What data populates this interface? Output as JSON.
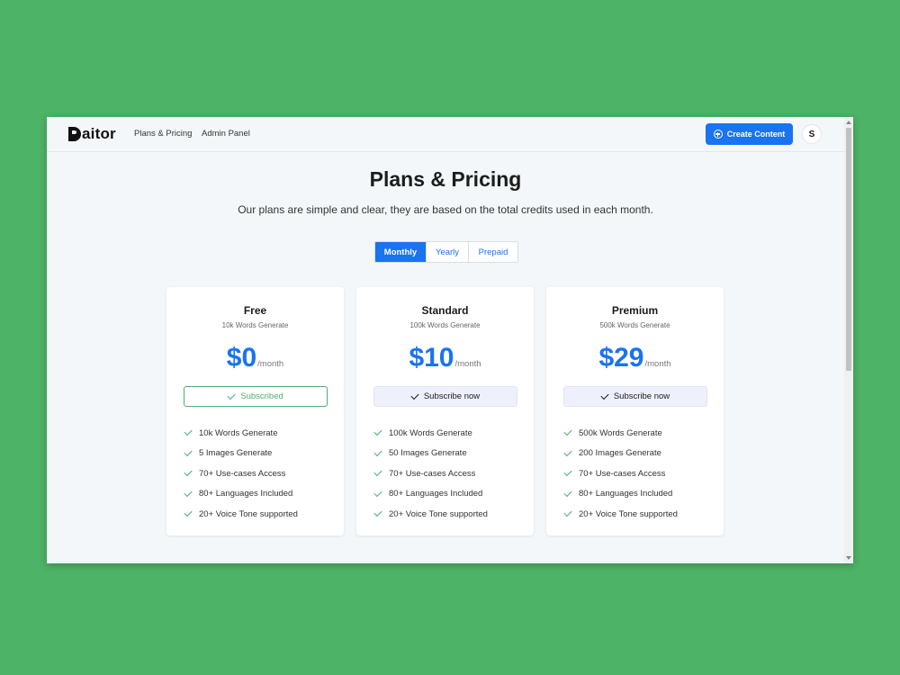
{
  "brand": {
    "logo_text": "aitor"
  },
  "nav": {
    "links": [
      "Plans & Pricing",
      "Admin Panel"
    ],
    "create_button": "Create Content",
    "avatar_initial": "S"
  },
  "page": {
    "title": "Plans & Pricing",
    "subtitle": "Our plans are simple and clear, they are based on the total credits used in each month."
  },
  "billing_toggle": {
    "options": [
      "Monthly",
      "Yearly",
      "Prepaid"
    ],
    "selected": "Monthly"
  },
  "plans": [
    {
      "name": "Free",
      "subtitle": "10k Words Generate",
      "price": "$0",
      "period": "/month",
      "button_label": "Subscribed",
      "subscribed": true,
      "features": [
        "10k Words Generate",
        "5 Images Generate",
        "70+ Use-cases Access",
        "80+ Languages Included",
        "20+ Voice Tone supported"
      ]
    },
    {
      "name": "Standard",
      "subtitle": "100k Words Generate",
      "price": "$10",
      "period": "/month",
      "button_label": "Subscribe now",
      "subscribed": false,
      "features": [
        "100k Words Generate",
        "50 Images Generate",
        "70+ Use-cases Access",
        "80+ Languages Included",
        "20+ Voice Tone supported"
      ]
    },
    {
      "name": "Premium",
      "subtitle": "500k Words Generate",
      "price": "$29",
      "period": "/month",
      "button_label": "Subscribe now",
      "subscribed": false,
      "features": [
        "500k Words Generate",
        "200 Images Generate",
        "70+ Use-cases Access",
        "80+ Languages Included",
        "20+ Voice Tone supported"
      ]
    }
  ],
  "colors": {
    "background": "#4db366",
    "accent": "#1a73f0",
    "success": "#4caf6e"
  }
}
